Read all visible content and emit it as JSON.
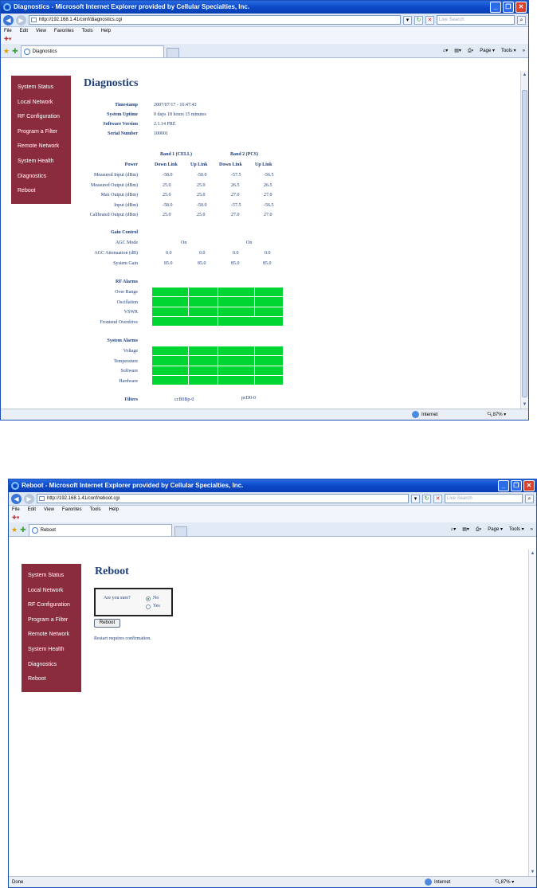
{
  "diag_window": {
    "title": "Diagnostics - Microsoft Internet Explorer provided by Cellular Specialties, Inc.",
    "url": "http://192.168.1.41/conf/diagnostics.cgi",
    "search_placeholder": "Live Search",
    "menu": [
      "File",
      "Edit",
      "View",
      "Favorites",
      "Tools",
      "Help"
    ],
    "tab_label": "Diagnostics",
    "tools": [
      "Page ▾",
      "Tools ▾"
    ],
    "status_zone": "Internet",
    "zoom": "87%"
  },
  "sidebar": {
    "items": [
      "System Status",
      "Local Network",
      "RF Configuration",
      "Program a Filter",
      "Remote Network",
      "System Health",
      "Diagnostics",
      "Reboot"
    ]
  },
  "diag": {
    "heading": "Diagnostics",
    "info": [
      {
        "label": "Timestamp",
        "value": "2007/07/17 - 16:47:43"
      },
      {
        "label": "System Uptime",
        "value": "0 days 18 hours 15 minutes"
      },
      {
        "label": "Software Version",
        "value": "2.1.14 PRE"
      },
      {
        "label": "Serial Number",
        "value": "100001"
      }
    ],
    "band_headers": [
      "Band 1 (CELL)",
      "Band 2 (PCS)"
    ],
    "power_label": "Power",
    "link_headers": [
      "Down Link",
      "Up Link",
      "Down Link",
      "Up Link"
    ],
    "power_rows": [
      {
        "label": "Measured Input (dBm)",
        "values": [
          "-58.0",
          "-50.0",
          "-57.5",
          "-56.5"
        ]
      },
      {
        "label": "Measured Output (dBm)",
        "values": [
          "25.0",
          "25.0",
          "26.5",
          "26.5"
        ]
      },
      {
        "label": "Max Output (dBm)",
        "values": [
          "25.0",
          "25.0",
          "27.0",
          "27.0"
        ]
      },
      {
        "label": "Input (dBm)",
        "values": [
          "-58.0",
          "-50.0",
          "-57.5",
          "-56.5"
        ]
      },
      {
        "label": "Calibrated Output (dBm)",
        "values": [
          "25.0",
          "25.0",
          "27.0",
          "27.0"
        ]
      }
    ],
    "gain_heading": "Gain Control",
    "agc_mode": {
      "label": "AGC Mode",
      "values": [
        "On",
        "On"
      ]
    },
    "agc_atten": {
      "label": "AGC Attenuation (dB)",
      "values": [
        "0.0",
        "0.0",
        "0.0",
        "0.0"
      ]
    },
    "system_gain": {
      "label": "System Gain",
      "values": [
        "85.0",
        "85.0",
        "85.0",
        "85.0"
      ]
    },
    "rf_alarms_heading": "RF Alarms",
    "rf_alarms": [
      "Over Range",
      "Oscillation",
      "VSWR",
      "Frontend Overdrive"
    ],
    "sys_alarms_heading": "System Alarms",
    "sys_alarms": [
      "Voltage",
      "Temperature",
      "Software",
      "Hardware"
    ],
    "alarm_color": "#00d632",
    "filters_label": "Filters",
    "filters": [
      "ccB0Bp-0",
      "pcD0-0"
    ]
  },
  "reboot_window": {
    "title": "Reboot - Microsoft Internet Explorer provided by Cellular Specialties, Inc.",
    "url": "http://192.168.1.41/conf/reboot.cgi",
    "search_placeholder": "Live Search",
    "menu": [
      "File",
      "Edit",
      "View",
      "Favorites",
      "Tools",
      "Help"
    ],
    "tab_label": "Reboot",
    "tools": [
      "Page ▾",
      "Tools ▾"
    ],
    "status_left": "Done",
    "status_zone": "Internet",
    "zoom": "87%"
  },
  "reboot": {
    "heading": "Reboot",
    "question": "Are you sure?",
    "options": [
      "No",
      "Yes"
    ],
    "selected": "No",
    "button": "Reboot",
    "note": "Restart requires confirmation."
  },
  "colors": {
    "sidebar_bg": "#8b2b3e",
    "heading": "#1f3f7a",
    "titlebar": "#0b49c8"
  }
}
